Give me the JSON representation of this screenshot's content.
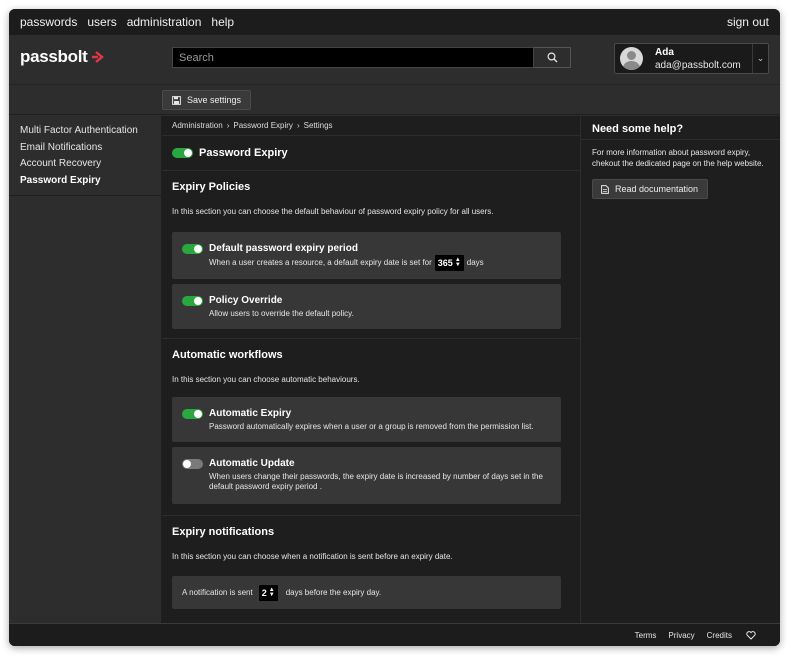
{
  "topnav": {
    "items": [
      "passwords",
      "users",
      "administration",
      "help"
    ],
    "sign_out": "sign out"
  },
  "header": {
    "logo_text": "passbolt",
    "search_placeholder": "Search",
    "user": {
      "name": "Ada",
      "email": "ada@passbolt.com"
    }
  },
  "actionbar": {
    "save_label": "Save settings"
  },
  "sidebar": {
    "items": [
      {
        "label": "Multi Factor Authentication"
      },
      {
        "label": "Email Notifications"
      },
      {
        "label": "Account Recovery"
      },
      {
        "label": "Password Expiry"
      }
    ]
  },
  "breadcrumb": [
    "Administration",
    "Password Expiry",
    "Settings"
  ],
  "main": {
    "title": "Password Expiry",
    "title_toggle": "on",
    "policies": {
      "title": "Expiry Policies",
      "description": "In this section you can choose the default behaviour of password expiry policy for all users.",
      "default_period": {
        "title": "Default password expiry period",
        "desc_before": "When a user creates a resource, a default expiry date is set for",
        "value": "365",
        "desc_after": "days",
        "toggle": "on"
      },
      "override": {
        "title": "Policy Override",
        "desc": "Allow users to override the default policy.",
        "toggle": "on"
      }
    },
    "workflows": {
      "title": "Automatic workflows",
      "description": "In this section you can choose automatic behaviours.",
      "auto_expiry": {
        "title": "Automatic Expiry",
        "desc": "Password automatically expires when a user or a group is removed from the permission list.",
        "toggle": "on"
      },
      "auto_update": {
        "title": "Automatic Update",
        "desc_line1": "When users change their passwords, the expiry date is increased by number of days set in the",
        "desc_line2": "default password expiry period .",
        "toggle": "off"
      }
    },
    "notifications": {
      "title": "Expiry notifications",
      "description": "In this section you can choose when a notification is sent before an expiry date.",
      "desc_before": "A notification is sent",
      "value": "2",
      "desc_after": "days before the expiry day."
    }
  },
  "help": {
    "title": "Need some help?",
    "text_line1": "For more information about password expiry,",
    "text_line2": "chekout the dedicated page on the help website.",
    "button": "Read documentation"
  },
  "footer": {
    "links": [
      "Terms",
      "Privacy",
      "Credits"
    ]
  },
  "colors": {
    "accent_red": "#e2374b",
    "toggle_on": "#2aa83f",
    "toggle_off": "#7a7a7a"
  }
}
